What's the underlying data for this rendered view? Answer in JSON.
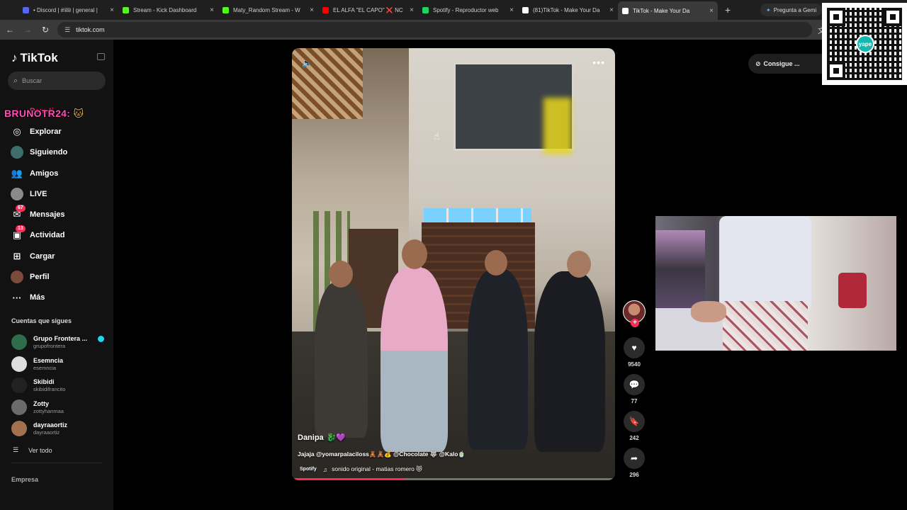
{
  "browser": {
    "tabs": [
      {
        "title": "• Discord | #🎟 | general |",
        "favicon_color": "#5865f2",
        "active": false
      },
      {
        "title": "Stream - Kick Dashboard",
        "favicon_color": "#53fc18",
        "active": false
      },
      {
        "title": "Maty_Random Stream - W",
        "favicon_color": "#53fc18",
        "active": false
      },
      {
        "title": "EL ALFA \"EL CAPO\" ❌ NC",
        "favicon_color": "#ff0000",
        "active": false
      },
      {
        "title": "Spotify - Reproductor web",
        "favicon_color": "#1ed760",
        "active": false
      },
      {
        "title": "(81)TikTok - Make Your Da",
        "favicon_color": "#ffffff",
        "active": false
      },
      {
        "title": "TikTok - Make Your Da",
        "favicon_color": "#ffffff",
        "active": true
      }
    ],
    "new_tab": "+",
    "gemini_label": "Pregunta a Gemi",
    "url": "tiktok.com"
  },
  "sidebar": {
    "logo": "TikTok",
    "search_placeholder": "Buscar",
    "overlay_name": "BRUNOTR24:",
    "overlay_cat": "🐱",
    "menu": [
      {
        "label": "Para ti",
        "icon": "home-icon",
        "glyph": "⌂",
        "badge": ""
      },
      {
        "label": "Explorar",
        "icon": "compass-icon",
        "glyph": "◎",
        "badge": ""
      },
      {
        "label": "Siguiendo",
        "icon": "following-avatar",
        "glyph": "",
        "badge": ""
      },
      {
        "label": "Amigos",
        "icon": "friends-icon",
        "glyph": "👥",
        "badge": ""
      },
      {
        "label": "LIVE",
        "icon": "live-avatar",
        "glyph": "",
        "badge": ""
      },
      {
        "label": "Mensajes",
        "icon": "messages-icon",
        "glyph": "✉",
        "badge": "67"
      },
      {
        "label": "Actividad",
        "icon": "activity-icon",
        "glyph": "▣",
        "badge": "13"
      },
      {
        "label": "Cargar",
        "icon": "upload-icon",
        "glyph": "⊞",
        "badge": ""
      },
      {
        "label": "Perfil",
        "icon": "profile-avatar",
        "glyph": "",
        "badge": ""
      },
      {
        "label": "Más",
        "icon": "more-icon",
        "glyph": "···",
        "badge": ""
      }
    ],
    "following_title": "Cuentas que sigues",
    "following": [
      {
        "name": "Grupo Frontera ...",
        "username": "grupofrontera",
        "verified": true,
        "color": "#2f6d4a"
      },
      {
        "name": "Esemncia",
        "username": "esemncia",
        "verified": false,
        "color": "#dddddd"
      },
      {
        "name": "Skibidi",
        "username": "skibidifrancito",
        "verified": false,
        "color": "#222222"
      },
      {
        "name": "Zotty",
        "username": "zottyhanmaa",
        "verified": false,
        "color": "#6b6b6b"
      },
      {
        "name": "dayraaortiz",
        "username": "dayraaortiz",
        "verified": false,
        "color": "#a37150"
      }
    ],
    "see_all": "Ver todo",
    "footer": "Empresa"
  },
  "video": {
    "author": "Danipa",
    "author_emoji": "🐉💜",
    "description": "Jajaja @yomarpalaciloss🧸🧸💰 @Chocolate 🐺 @Kalo🍵",
    "spotify_tag": "Spotify",
    "music": "sonido original - matias romero 😻",
    "progress_fraction": 0.35,
    "likes": "9540",
    "comments": "77",
    "saves": "242",
    "shares": "296"
  },
  "right": {
    "get_button": "Consigue ...",
    "qr_brand": "yape"
  }
}
